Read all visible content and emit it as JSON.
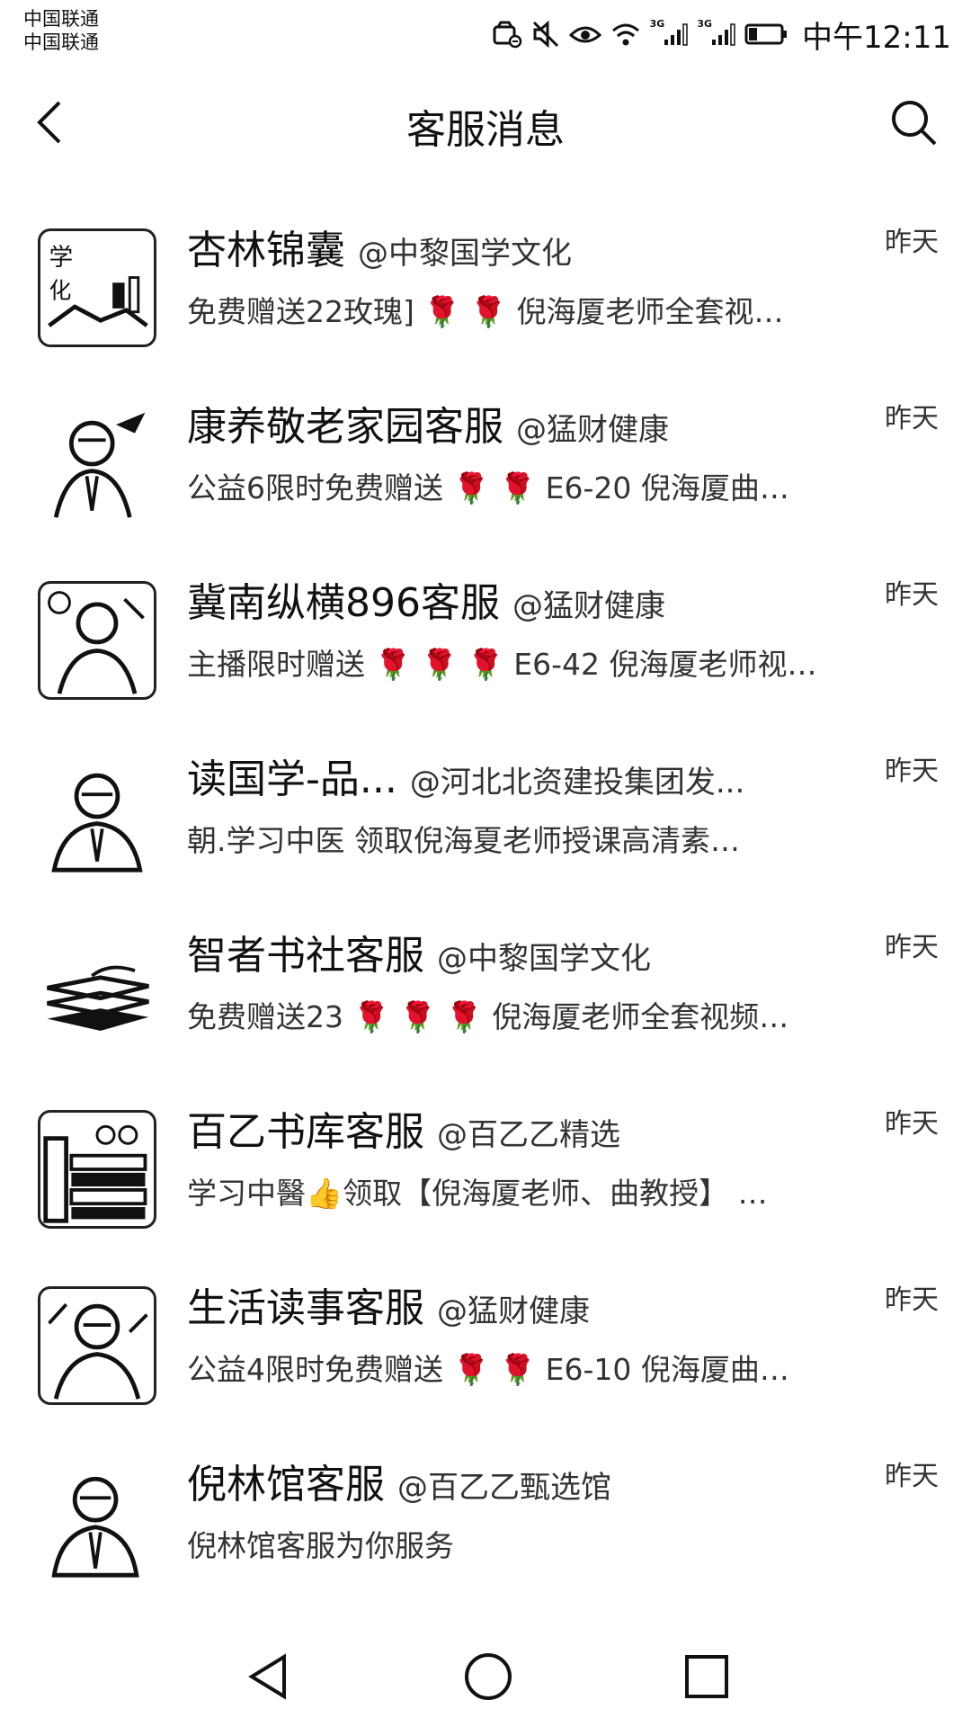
{
  "status_bar": {
    "carrier_1": "中国联通",
    "carrier_2": "中国联通",
    "network_1": "3G",
    "network_2": "3G",
    "time": "中午12:11",
    "icons": [
      "lock-car-icon",
      "mute-icon",
      "eye-comfort-icon",
      "wifi-icon",
      "signal-icon",
      "battery-icon"
    ]
  },
  "header": {
    "title": "客服消息",
    "back_icon": "back-arrow-icon",
    "search_icon": "search-icon"
  },
  "messages": [
    {
      "name": "杏林锦囊",
      "source": "@中黎国学文化",
      "preview": "免费赠送22玫瑰] 🌹 🌹 倪海厦老师全套视…",
      "time": "昨天",
      "avatar": "book-calligraphy-avatar"
    },
    {
      "name": "康养敬老家园客服",
      "source": "@猛财健康",
      "preview": "公益6限时免费赠送 🌹 🌹 E6-20 倪海厦曲…",
      "time": "昨天",
      "avatar": "teacher-portrait-avatar"
    },
    {
      "name": "冀南纵横896客服",
      "source": "@猛财健康",
      "preview": "主播限时赠送 🌹 🌹 🌹 E6-42 倪海厦老师视…",
      "time": "昨天",
      "avatar": "teacher-portrait-avatar"
    },
    {
      "name": "读国学-品...",
      "source": "@河北北资建投集团发...",
      "preview": "朝.学习中医 领取倪海夏老师授课高清素…",
      "time": "昨天",
      "avatar": "teacher-portrait-avatar"
    },
    {
      "name": "智者书社客服",
      "source": "@中黎国学文化",
      "preview": "免费赠送23 🌹 🌹 🌹 倪海厦老师全套视频…",
      "time": "昨天",
      "avatar": "open-books-avatar"
    },
    {
      "name": "百乙书库客服",
      "source": "@百乙乙精选",
      "preview": "学习中醫👍领取【倪海厦老师、曲教授】 …",
      "time": "昨天",
      "avatar": "book-stack-avatar"
    },
    {
      "name": "生活读事客服",
      "source": "@猛财健康",
      "preview": "公益4限时免费赠送 🌹 🌹 E6-10 倪海厦曲…",
      "time": "昨天",
      "avatar": "teacher-portrait-avatar"
    },
    {
      "name": "倪林馆客服",
      "source": "@百乙乙甄选馆",
      "preview": "倪林馆客服为你服务",
      "time": "昨天",
      "avatar": "teacher-portrait-avatar"
    }
  ],
  "nav_bar": {
    "icons": [
      "nav-back-icon",
      "nav-home-icon",
      "nav-recent-icon"
    ]
  }
}
